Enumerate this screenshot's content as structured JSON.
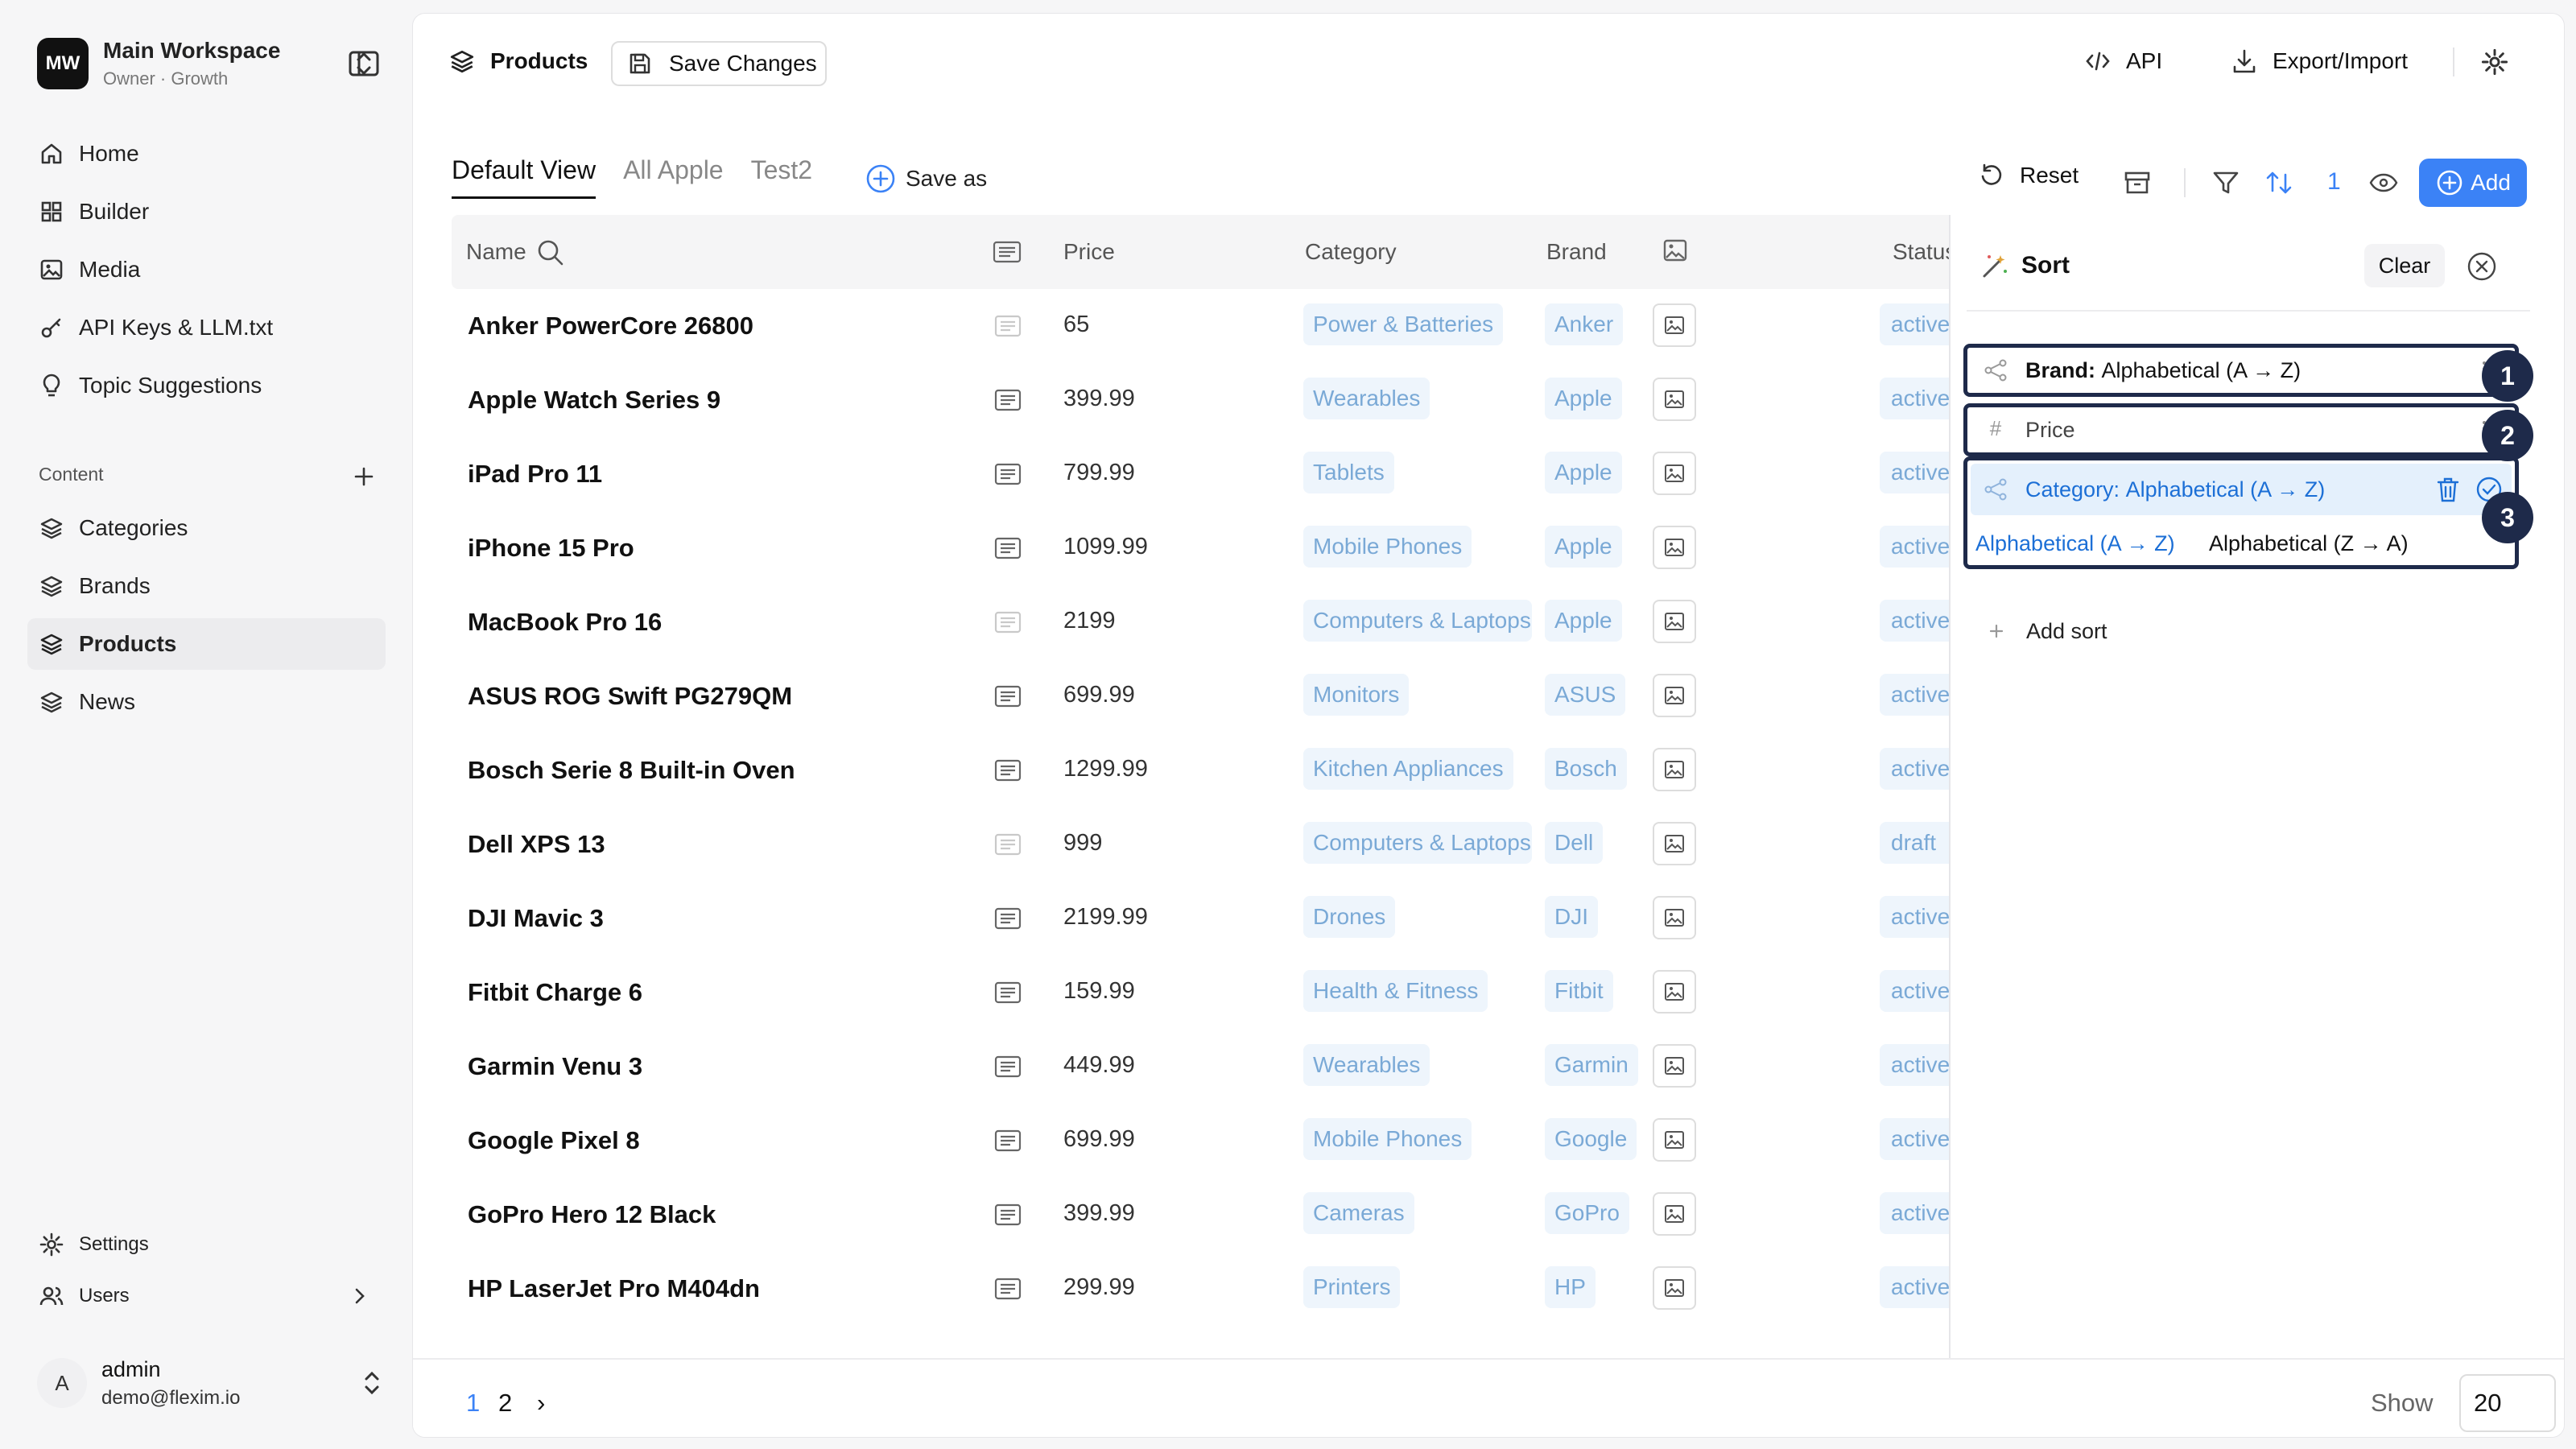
{
  "workspace": {
    "initials": "MW",
    "name": "Main Workspace",
    "subtitle": "Owner · Growth"
  },
  "nav": {
    "home": "Home",
    "builder": "Builder",
    "media": "Media",
    "api_keys": "API Keys & LLM.txt",
    "topics": "Topic Suggestions",
    "section": "Content",
    "categories": "Categories",
    "brands": "Brands",
    "products": "Products",
    "news": "News",
    "settings": "Settings",
    "users": "Users"
  },
  "user": {
    "initial": "A",
    "name": "admin",
    "email": "demo@flexim.io"
  },
  "topbar": {
    "title": "Products",
    "save": "Save Changes",
    "api": "API",
    "export": "Export/Import"
  },
  "views": {
    "tabs": [
      "Default View",
      "All Apple",
      "Test2"
    ],
    "save_as": "Save as"
  },
  "toolbar": {
    "reset": "Reset",
    "sort_count": "1",
    "add": "Add"
  },
  "columns": {
    "name": "Name",
    "price": "Price",
    "category": "Category",
    "brand": "Brand",
    "status": "Status"
  },
  "rows": [
    {
      "name": "Anker PowerCore 26800",
      "price": "65",
      "category": "Power & Batteries",
      "brand": "Anker",
      "status": "active"
    },
    {
      "name": "Apple Watch Series 9",
      "price": "399.99",
      "category": "Wearables",
      "brand": "Apple",
      "status": "active"
    },
    {
      "name": "iPad Pro 11",
      "price": "799.99",
      "category": "Tablets",
      "brand": "Apple",
      "status": "active"
    },
    {
      "name": "iPhone 15 Pro",
      "price": "1099.99",
      "category": "Mobile Phones",
      "brand": "Apple",
      "status": "active"
    },
    {
      "name": "MacBook Pro 16",
      "price": "2199",
      "category": "Computers & Laptops",
      "brand": "Apple",
      "status": "active"
    },
    {
      "name": "ASUS ROG Swift PG279QM",
      "price": "699.99",
      "category": "Monitors",
      "brand": "ASUS",
      "status": "active"
    },
    {
      "name": "Bosch Serie 8 Built-in Oven",
      "price": "1299.99",
      "category": "Kitchen Appliances",
      "brand": "Bosch",
      "status": "active"
    },
    {
      "name": "Dell XPS 13",
      "price": "999",
      "category": "Computers & Laptops",
      "brand": "Dell",
      "status": "draft"
    },
    {
      "name": "DJI Mavic 3",
      "price": "2199.99",
      "category": "Drones",
      "brand": "DJI",
      "status": "active"
    },
    {
      "name": "Fitbit Charge 6",
      "price": "159.99",
      "category": "Health & Fitness",
      "brand": "Fitbit",
      "status": "active"
    },
    {
      "name": "Garmin Venu 3",
      "price": "449.99",
      "category": "Wearables",
      "brand": "Garmin",
      "status": "active"
    },
    {
      "name": "Google Pixel 8",
      "price": "699.99",
      "category": "Mobile Phones",
      "brand": "Google",
      "status": "active"
    },
    {
      "name": "GoPro Hero 12 Black",
      "price": "399.99",
      "category": "Cameras",
      "brand": "GoPro",
      "status": "active"
    },
    {
      "name": "HP LaserJet Pro M404dn",
      "price": "299.99",
      "category": "Printers",
      "brand": "HP",
      "status": "active"
    }
  ],
  "sort_panel": {
    "title": "Sort",
    "clear": "Clear",
    "add_sort": "Add sort",
    "items": [
      {
        "field": "Brand:",
        "value": "Alphabetical (A → Z)",
        "badge": "1"
      },
      {
        "field": "Price",
        "value": "",
        "badge": "2"
      },
      {
        "field": "Category:",
        "value": "Alphabetical (A → Z)",
        "badge": "3"
      }
    ],
    "options": [
      "Alphabetical (A → Z)",
      "Alphabetical (Z → A)"
    ]
  },
  "pagination": {
    "pages": [
      "1",
      "2"
    ],
    "next": "›",
    "show_label": "Show",
    "page_size": "20"
  },
  "colors": {
    "accent": "#3b82f6",
    "badge": "#1e2a4a",
    "tag_bg": "#eef5fc",
    "tag_text": "#7aa9d6"
  }
}
